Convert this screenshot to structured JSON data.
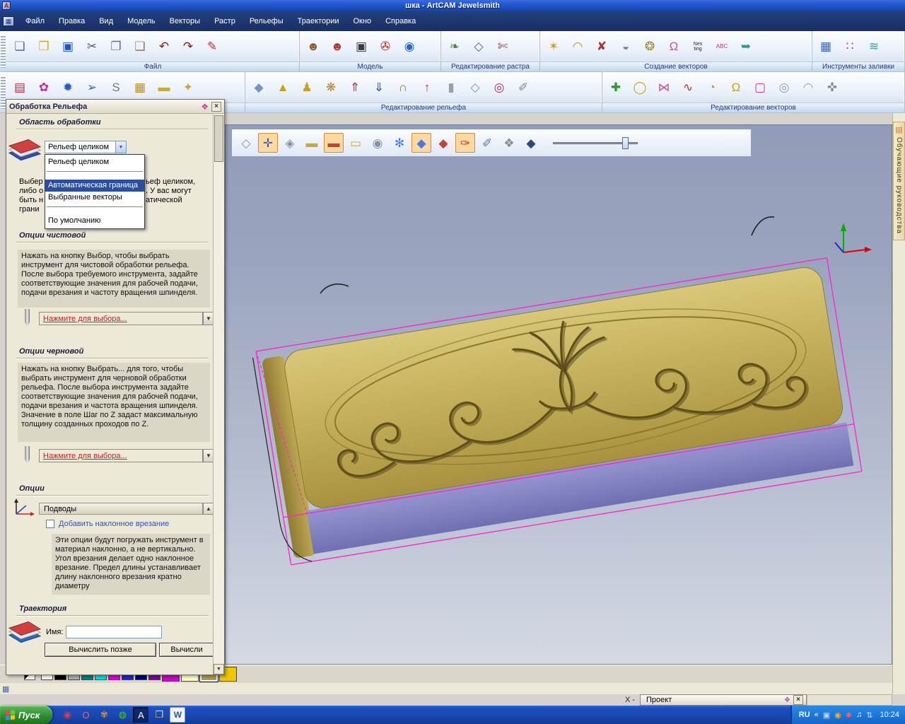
{
  "titlebar": {
    "title": "шка - ArtCAM Jewelsmith",
    "app_initial": "A"
  },
  "menubar": {
    "items": [
      "Файл",
      "Правка",
      "Вид",
      "Модель",
      "Векторы",
      "Растр",
      "Рельефы",
      "Траектории",
      "Окно",
      "Справка"
    ]
  },
  "colors": {
    "titlebar_blue": "#2156cc",
    "gold": "#c2ae58",
    "plaque_side": "#8f7c34",
    "front_face": "#7f80c0",
    "wire": "#ff22cc",
    "selection_blue": "#2a4fa0",
    "link_red": "#cc2222",
    "toolbar_highlight": "#fcd9a0"
  },
  "toolbar1": {
    "groups": [
      {
        "label": "Файл",
        "icons": [
          {
            "name": "new-document-icon",
            "glyph": "❏",
            "fg": "#4a6da8"
          },
          {
            "name": "open-folder-icon",
            "glyph": "❒",
            "fg": "#d9a51b"
          },
          {
            "name": "save-icon",
            "glyph": "▣",
            "fg": "#2458b8"
          },
          {
            "name": "cut-icon",
            "glyph": "✂",
            "fg": "#556070"
          },
          {
            "name": "copy-icon",
            "glyph": "❐",
            "fg": "#667088"
          },
          {
            "name": "paste-icon",
            "glyph": "❑",
            "fg": "#9a7b2f"
          },
          {
            "name": "undo-icon",
            "glyph": "↶",
            "fg": "#7a2020"
          },
          {
            "name": "redo-icon",
            "glyph": "↷",
            "fg": "#7a2020"
          },
          {
            "name": "signature-icon",
            "glyph": "✎",
            "fg": "#c03030"
          }
        ]
      },
      {
        "label": "Модель",
        "icons": [
          {
            "name": "teddy-bear-icon",
            "glyph": "☻",
            "fg": "#8a5a2a"
          },
          {
            "name": "teddy-bear-color-icon",
            "glyph": "☻",
            "fg": "#b0342a"
          },
          {
            "name": "greyscale-view-icon",
            "glyph": "▣",
            "fg": "#3a3a3a"
          },
          {
            "name": "render-tool-icon",
            "glyph": "✇",
            "fg": "#c02020"
          },
          {
            "name": "sphere-view-icon",
            "glyph": "◉",
            "fg": "#2868c8"
          }
        ]
      },
      {
        "label": "Редактирование растра",
        "icons": [
          {
            "name": "bitmap-leaf-icon",
            "glyph": "❧",
            "fg": "#4a8a3a"
          },
          {
            "name": "vector-outline-icon",
            "glyph": "◇",
            "fg": "#556688"
          },
          {
            "name": "trim-bitmap-icon",
            "glyph": "✄",
            "fg": "#884444"
          }
        ]
      },
      {
        "label": "Создание векторов",
        "icons": [
          {
            "name": "star-tool-icon",
            "glyph": "✶",
            "fg": "#d4a017"
          },
          {
            "name": "arc-tool-icon",
            "glyph": "◠",
            "fg": "#c8960c"
          },
          {
            "name": "delete-vector-icon",
            "glyph": "✘",
            "fg": "#b03030"
          },
          {
            "name": "measure-icon",
            "glyph": "◒",
            "fg": "#778899"
          },
          {
            "name": "gears-icon",
            "glyph": "❂",
            "fg": "#9a8a2a"
          },
          {
            "name": "bag-icon",
            "glyph": "Ω",
            "fg": "#c05898"
          },
          {
            "name": "nesting-icon",
            "glyph": "Nes\nting",
            "fg": "#222222",
            "fs": 7
          },
          {
            "name": "text-tool-icon",
            "glyph": "ABC",
            "fg": "#c03088",
            "fs": 8
          },
          {
            "name": "swoosh-icon",
            "glyph": "➥",
            "fg": "#2a9a9a"
          }
        ]
      },
      {
        "label": "Инструменты заливки",
        "icons": [
          {
            "name": "flood-fill-icon",
            "glyph": "▦",
            "fg": "#3a6ab8"
          },
          {
            "name": "dot-fill-icon",
            "glyph": "∷",
            "fg": "#b03090"
          },
          {
            "name": "wave-fill-icon",
            "glyph": "≋",
            "fg": "#3a9ab0"
          }
        ]
      }
    ]
  },
  "toolbar2": {
    "left_icons": [
      {
        "name": "relief-layer-icon",
        "glyph": "▤",
        "fg": "#b03040"
      },
      {
        "name": "shape-editor-icon",
        "glyph": "✿",
        "fg": "#c82898"
      },
      {
        "name": "texture-relief-icon",
        "glyph": "✹",
        "fg": "#2858c0"
      },
      {
        "name": "profile-tool-icon",
        "glyph": "➢",
        "fg": "#2868b8"
      },
      {
        "name": "smooth-relief-icon",
        "glyph": "S",
        "fg": "#777777"
      },
      {
        "name": "weave-texture-icon",
        "glyph": "▦",
        "fg": "#b8912a"
      },
      {
        "name": "flat-plane-icon",
        "glyph": "▬",
        "fg": "#c8a83a"
      },
      {
        "name": "star-relief-icon",
        "glyph": "✦",
        "fg": "#c8a83a"
      }
    ],
    "groups": [
      {
        "label": "Редактирование рельефа",
        "icons": [
          {
            "name": "select-relief-icon",
            "glyph": "◆",
            "fg": "#7a92c8"
          },
          {
            "name": "dome-tool-icon",
            "glyph": "▲",
            "fg": "#c8a020"
          },
          {
            "name": "spin-tool-icon",
            "glyph": "♟",
            "fg": "#c8a020"
          },
          {
            "name": "carousel-icon",
            "glyph": "❋",
            "fg": "#b08828"
          },
          {
            "name": "raise-relief-icon",
            "glyph": "⇑",
            "fg": "#b03030"
          },
          {
            "name": "lower-relief-icon",
            "glyph": "⇓",
            "fg": "#3050b0"
          },
          {
            "name": "lock-relief-icon",
            "glyph": "∩",
            "fg": "#8a7a2a"
          },
          {
            "name": "offset-up-icon",
            "glyph": "↑",
            "fg": "#c03030"
          },
          {
            "name": "column-icon",
            "glyph": "▮",
            "fg": "#98a0b0"
          },
          {
            "name": "plane-relief-icon",
            "glyph": "◇",
            "fg": "#7a92c8"
          },
          {
            "name": "target-icon",
            "glyph": "◎",
            "fg": "#b03060"
          },
          {
            "name": "carve-icon",
            "glyph": "✐",
            "fg": "#888888"
          }
        ]
      },
      {
        "label": "Редактирование векторов",
        "icons": [
          {
            "name": "add-vector-icon",
            "glyph": "✚",
            "fg": "#2a9a2a"
          },
          {
            "name": "ring-icon",
            "glyph": "◯",
            "fg": "#c8a020"
          },
          {
            "name": "hourglass-icon",
            "glyph": "⋈",
            "fg": "#c850a0"
          },
          {
            "name": "scribble-icon",
            "glyph": "∿",
            "fg": "#c03030"
          },
          {
            "name": "pacman-icon",
            "glyph": "◔",
            "fg": "#c8a020"
          },
          {
            "name": "bell-icon",
            "glyph": "Ω",
            "fg": "#c8a020"
          },
          {
            "name": "marquee-icon",
            "glyph": "▢",
            "fg": "#c830a0"
          },
          {
            "name": "circles-icon",
            "glyph": "◎",
            "fg": "#98a0b0"
          },
          {
            "name": "arc-vector-icon",
            "glyph": "◠",
            "fg": "#98a0b0"
          },
          {
            "name": "node-edit-icon",
            "glyph": "✜",
            "fg": "#888888"
          }
        ]
      }
    ]
  },
  "viewport": {
    "toolbar_icons": [
      {
        "name": "draw-plane-icon",
        "glyph": "◇",
        "fg": "#8890a8"
      },
      {
        "name": "draw-axes-icon",
        "glyph": "✛",
        "fg": "#2858c8",
        "sel": true
      },
      {
        "name": "shade-view-icon",
        "glyph": "◈",
        "fg": "#8890a8"
      },
      {
        "name": "block-view-icon",
        "glyph": "▬",
        "fg": "#c8a83a"
      },
      {
        "name": "block-material-icon",
        "glyph": "▬",
        "fg": "#c84030",
        "sel": true
      },
      {
        "name": "block-small-icon",
        "glyph": "▭",
        "fg": "#c8a83a"
      },
      {
        "name": "circle-plane-icon",
        "glyph": "◉",
        "fg": "#8890a8"
      },
      {
        "name": "snowflake-icon",
        "glyph": "✻",
        "fg": "#4878e8"
      },
      {
        "name": "multi-view-icon",
        "glyph": "◆",
        "fg": "#4878e8",
        "sel": true
      },
      {
        "name": "red-plane-icon",
        "glyph": "◆",
        "fg": "#c84030"
      },
      {
        "name": "simulate-toolpath-icon",
        "glyph": "✑",
        "fg": "#c84030",
        "sel": true
      },
      {
        "name": "brush-icon",
        "glyph": "✐",
        "fg": "#5878a8"
      },
      {
        "name": "material-setup-icon",
        "glyph": "❖",
        "fg": "#888888"
      },
      {
        "name": "diamond-view-icon",
        "glyph": "◆",
        "fg": "#304878"
      }
    ]
  },
  "panel": {
    "title": "Обработка Рельефа",
    "close_glyph": "×",
    "h_area": "Область обработки",
    "combo_value": "Рельеф целиком",
    "combo_arrow": "▼",
    "dropdown": [
      {
        "label": "Рельеф целиком"
      },
      {
        "sep": true
      },
      {
        "label": "Автоматическая граница",
        "sel": true
      },
      {
        "label": "Выбранные векторы"
      },
      {
        "sep": true
      },
      {
        "label": "По умолчанию"
      }
    ],
    "frag_left": [
      "Выбер",
      "либо о",
      "быть н",
      "грани"
    ],
    "frag_right": [
      "ьеф целиком,",
      ". У вас могут",
      "атической"
    ],
    "h_finish": "Опции чистовой",
    "finish_text": "Нажать на кнопку Выбор, чтобы выбрать инструмент для чистовой обработки рельефа. После выбора требуемого инструмента, задайте соответствующие значения для рабочей подачи, подачи врезания и частоту вращения шпинделя.",
    "select_link": "Нажмите для выбора...",
    "h_rough": "Опции черновой",
    "rough_text": "Нажать на кнопку Выбрать... для того, чтобы выбрать инструмент для черновой обработки рельефа. После выбора инструмента задайте соответствующие значения для рабочей подачи, подачи врезания и частота вращения шпинделя. Значение в поле Шаг по Z задаст максимальную толщину созданных проходов по Z.",
    "h_options": "Опции",
    "leads_label": "Подводы",
    "ramp_checkbox": "Добавить наклонное врезание",
    "ramp_text": "Эти опции будут погружать инструмент в материал наклонно, а не вертикально. Угол врезания делает одно наклонное врезание. Предел длины устанавливает длину наклонного врезания кратно диаметру",
    "h_toolpath": "Траектория",
    "name_label": "Имя:",
    "name_value": "",
    "btn_later": "Вычислить позже",
    "btn_now": "Вычисли"
  },
  "right_tab": {
    "label": "Обучающие руководства"
  },
  "palette": {
    "swatches": [
      {
        "name": "swatch-white",
        "bg": "#ffffff"
      },
      {
        "name": "swatch-black",
        "bg": "#000000"
      },
      {
        "name": "swatch-gray",
        "bg": "#b0b0b0"
      },
      {
        "name": "swatch-teal",
        "bg": "#008080"
      },
      {
        "name": "swatch-cyan",
        "bg": "#00e0e0"
      },
      {
        "name": "swatch-magenta",
        "bg": "#e000e0"
      },
      {
        "name": "swatch-blue",
        "bg": "#2020e0"
      },
      {
        "name": "swatch-navy",
        "bg": "#000080"
      },
      {
        "name": "swatch-purple",
        "bg": "#8000a0"
      },
      {
        "name": "swatch-violet",
        "bg": "#cc00cc",
        "cls": "big"
      },
      {
        "name": "swatch-cream",
        "bg": "#ffffc8",
        "cls": "big"
      },
      {
        "name": "swatch-olive",
        "bg": "#b09b4e",
        "cls": "big sel"
      },
      {
        "name": "swatch-gold",
        "bg": "#f0c800",
        "cls": "big"
      }
    ]
  },
  "statusbar": {
    "coord": "X -",
    "project_title": "Проект",
    "close_glyph": "×"
  },
  "taskbar": {
    "start": "Пуск",
    "lang": "RU",
    "time": "10:24",
    "quick": [
      {
        "name": "browser-icon",
        "glyph": "◉",
        "fg": "#e04030"
      },
      {
        "name": "opera-icon",
        "glyph": "O",
        "fg": "#ff6050"
      },
      {
        "name": "flower-icon",
        "glyph": "✾",
        "fg": "#e08820"
      },
      {
        "name": "media-icon",
        "glyph": "◍",
        "fg": "#50c050"
      },
      {
        "name": "artcam-task-icon",
        "glyph": "A",
        "fg": "#ffffff",
        "cls": "pressed"
      },
      {
        "name": "folder-icon",
        "glyph": "❒",
        "fg": "#ffd860"
      },
      {
        "name": "word-icon",
        "glyph": "W",
        "fg": "#2b579a",
        "cls": "chip"
      }
    ],
    "tray_icons": [
      {
        "name": "tray-chevron-icon",
        "glyph": "«",
        "fg": "#ffffff"
      },
      {
        "name": "display-icon",
        "glyph": "▣",
        "fg": "#bcd8ff"
      },
      {
        "name": "antivirus-icon",
        "glyph": "◉",
        "fg": "#ffb020"
      },
      {
        "name": "agent-icon",
        "glyph": "✱",
        "fg": "#ff6050"
      },
      {
        "name": "volume-icon",
        "glyph": "♫",
        "fg": "#ffffff"
      },
      {
        "name": "network-icon",
        "glyph": "⇅",
        "fg": "#cfe4ff"
      }
    ]
  }
}
